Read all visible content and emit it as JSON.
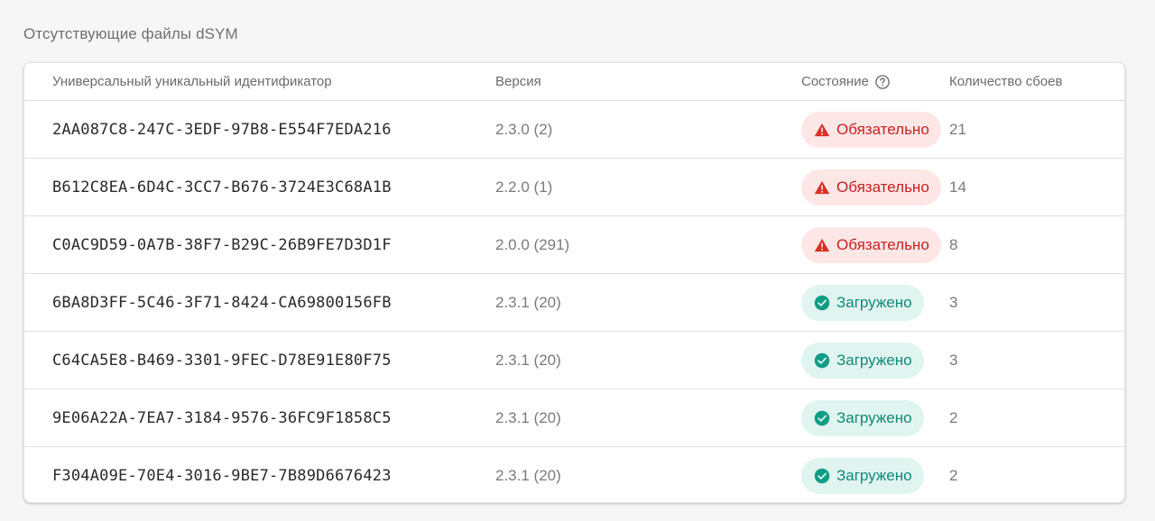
{
  "section": {
    "title": "Отсутствующие файлы dSYM"
  },
  "table": {
    "headers": {
      "uuid": "Универсальный уникальный идентификатор",
      "version": "Версия",
      "state": "Состояние",
      "count": "Количество сбоев"
    },
    "rows": [
      {
        "uuid": "2AA087C8-247C-3EDF-97B8-E554F7EDA216",
        "version": "2.3.0 (2)",
        "state": "Обязательно",
        "status": "required",
        "count": "21"
      },
      {
        "uuid": "B612C8EA-6D4C-3CC7-B676-3724E3C68A1B",
        "version": "2.2.0 (1)",
        "state": "Обязательно",
        "status": "required",
        "count": "14"
      },
      {
        "uuid": "C0AC9D59-0A7B-38F7-B29C-26B9FE7D3D1F",
        "version": "2.0.0 (291)",
        "state": "Обязательно",
        "status": "required",
        "count": "8"
      },
      {
        "uuid": "6BA8D3FF-5C46-3F71-8424-CA69800156FB",
        "version": "2.3.1 (20)",
        "state": "Загружено",
        "status": "uploaded",
        "count": "3"
      },
      {
        "uuid": "C64CA5E8-B469-3301-9FEC-D78E91E80F75",
        "version": "2.3.1 (20)",
        "state": "Загружено",
        "status": "uploaded",
        "count": "3"
      },
      {
        "uuid": "9E06A22A-7EA7-3184-9576-36FC9F1858C5",
        "version": "2.3.1 (20)",
        "state": "Загружено",
        "status": "uploaded",
        "count": "2"
      },
      {
        "uuid": "F304A09E-70E4-3016-9BE7-7B89D6676423",
        "version": "2.3.1 (20)",
        "state": "Загружено",
        "status": "uploaded",
        "count": "2"
      }
    ]
  },
  "icons": {
    "help": "help-circle-icon",
    "required": "warning-triangle-icon",
    "uploaded": "check-circle-icon"
  },
  "colors": {
    "required_text": "#c5221f",
    "required_bg": "#fde6e6",
    "uploaded_text": "#0f8a76",
    "uploaded_bg": "#e0f4f0"
  }
}
